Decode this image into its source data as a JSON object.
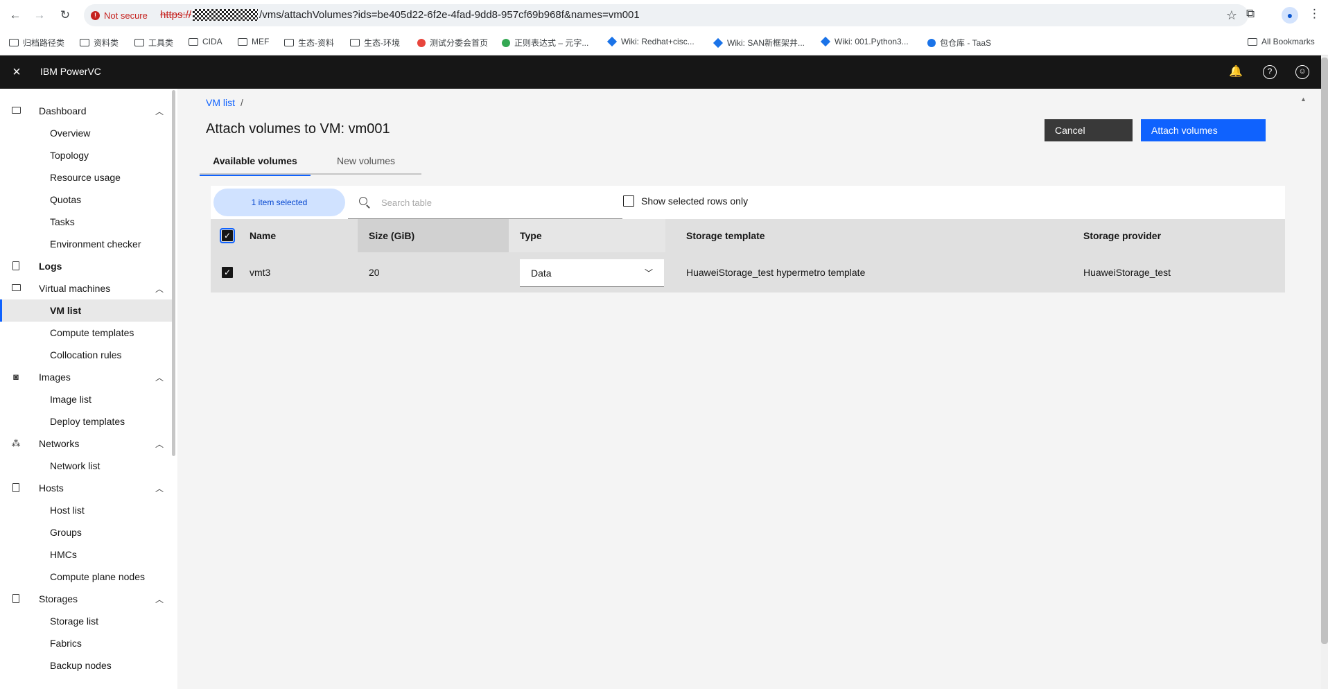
{
  "browser": {
    "security_label": "Not secure",
    "url_scheme": "https://",
    "url_path": "/vms/attachVolumes?ids=be405d22-6f2e-4fad-9dd8-957cf69b968f&names=vm001",
    "bookmarks": [
      {
        "label": "归档路径类",
        "icon": "folder-icon"
      },
      {
        "label": "资料类",
        "icon": "folder-icon"
      },
      {
        "label": "工具类",
        "icon": "folder-icon"
      },
      {
        "label": "CIDA",
        "icon": "folder-icon"
      },
      {
        "label": "MEF",
        "icon": "folder-icon"
      },
      {
        "label": "生态-资料",
        "icon": "folder-icon"
      },
      {
        "label": "生态-环境",
        "icon": "folder-icon"
      },
      {
        "label": "测试分委会首页",
        "icon": "site-icon"
      },
      {
        "label": "正则表达式 – 元字...",
        "icon": "site-icon"
      },
      {
        "label": "Wiki: Redhat+cisc...",
        "icon": "wiki-icon"
      },
      {
        "label": "Wiki: SAN新框架井...",
        "icon": "wiki-icon"
      },
      {
        "label": "Wiki: 001.Python3...",
        "icon": "wiki-icon"
      },
      {
        "label": "包仓库 - TaaS",
        "icon": "site-icon"
      }
    ],
    "all_bookmarks": "All Bookmarks"
  },
  "app": {
    "title": "IBM PowerVC"
  },
  "sidebar": {
    "groups": [
      {
        "label": "Dashboard",
        "icon": "monitor-icon",
        "expandable": true,
        "items": [
          "Overview",
          "Topology",
          "Resource usage",
          "Quotas",
          "Tasks",
          "Environment checker"
        ]
      },
      {
        "label": "Logs",
        "icon": "document-icon",
        "expandable": false,
        "items": []
      },
      {
        "label": "Virtual machines",
        "icon": "monitor-icon",
        "expandable": true,
        "items": [
          "VM list",
          "Compute templates",
          "Collocation rules"
        ]
      },
      {
        "label": "Images",
        "icon": "camera-icon",
        "expandable": true,
        "items": [
          "Image list",
          "Deploy templates"
        ]
      },
      {
        "label": "Networks",
        "icon": "network-icon",
        "expandable": true,
        "items": [
          "Network list"
        ]
      },
      {
        "label": "Hosts",
        "icon": "server-icon",
        "expandable": true,
        "items": [
          "Host list",
          "Groups",
          "HMCs",
          "Compute plane nodes"
        ]
      },
      {
        "label": "Storages",
        "icon": "storage-icon",
        "expandable": true,
        "items": [
          "Storage list",
          "Fabrics",
          "Backup nodes"
        ]
      }
    ],
    "active_item": "VM list"
  },
  "main": {
    "breadcrumb": {
      "link": "VM list",
      "separator": "/"
    },
    "title": "Attach volumes to VM: vm001",
    "buttons": {
      "cancel": "Cancel",
      "attach": "Attach volumes"
    },
    "tabs": [
      {
        "label": "Available volumes",
        "active": true
      },
      {
        "label": "New volumes",
        "active": false
      }
    ],
    "toolbar": {
      "selected_text": "1 item selected",
      "search_placeholder": "Search table",
      "show_selected_label": "Show selected rows only"
    },
    "table": {
      "columns": [
        "Name",
        "Size (GiB)",
        "Type",
        "Storage template",
        "Storage provider"
      ],
      "rows": [
        {
          "selected": true,
          "name": "vmt3",
          "size": "20",
          "type": "Data",
          "storage_template": "HuaweiStorage_test hypermetro template",
          "storage_provider": "HuaweiStorage_test"
        }
      ]
    }
  }
}
